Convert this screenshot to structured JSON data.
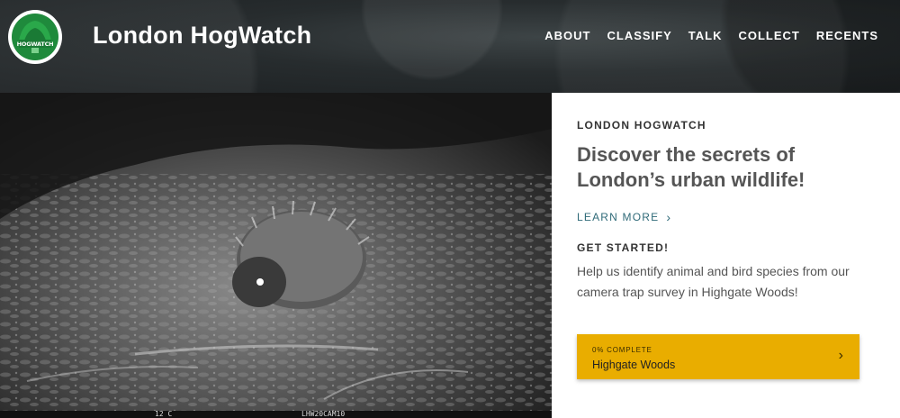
{
  "header": {
    "logo_text": "HOGWATCH",
    "site_title": "London HogWatch",
    "nav": [
      {
        "label": "ABOUT"
      },
      {
        "label": "CLASSIFY"
      },
      {
        "label": "TALK"
      },
      {
        "label": "COLLECT"
      },
      {
        "label": "RECENTS"
      }
    ]
  },
  "hero": {
    "caption_left": "12 C",
    "caption_right": "LHW20CAM10"
  },
  "panel": {
    "eyebrow": "LONDON HOGWATCH",
    "headline": "Discover the secrets of London’s urban wildlife!",
    "learn_more": "LEARN MORE",
    "get_started": "GET STARTED!",
    "intro": "Help us identify animal and bird species from our camera trap survey in Highgate Woods!",
    "workflow": {
      "progress": "0% COMPLETE",
      "name": "Highgate Woods"
    }
  },
  "colors": {
    "header_bg": "#272c2e",
    "cta_bg": "#e9ad00",
    "link": "#2f6a78"
  },
  "icons": [
    "logo-badge",
    "chevron-right-icon"
  ]
}
